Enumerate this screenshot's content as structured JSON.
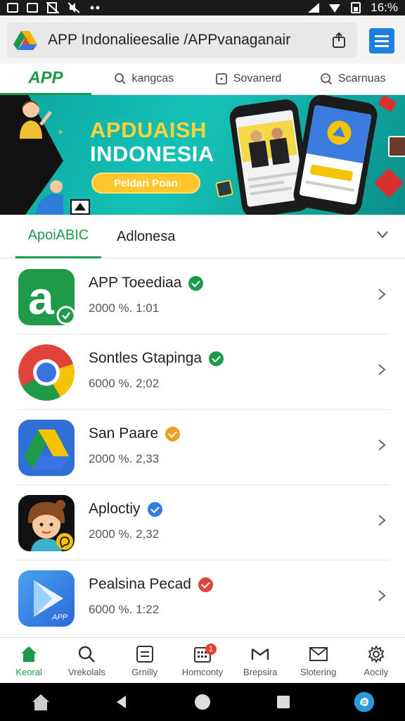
{
  "status_bar": {
    "time": "16:%",
    "left_icons": [
      "photo-icon",
      "mountain-icon",
      "no-sim-icon",
      "mute-icon",
      "dots-icon"
    ],
    "right_icons": [
      "signal-icon",
      "wifi-icon",
      "battery-icon"
    ]
  },
  "address_bar": {
    "url": "APP Indonalieesalie /APPvanaganair"
  },
  "top_tabs": {
    "logo": "APP",
    "items": [
      {
        "label": "kangcas",
        "icon": "search-icon"
      },
      {
        "label": "Sovanerd",
        "icon": "square-icon"
      },
      {
        "label": "Scarnuas",
        "icon": "smile-icon"
      }
    ]
  },
  "banner": {
    "title_line1": "APDUAISH",
    "title_line2": "INDONESIA",
    "button_label": "Peldari Poan"
  },
  "section_tabs": {
    "active": "ApoiABIC",
    "other": "Adlonesa"
  },
  "apps": [
    {
      "name": "APP Toeediaa",
      "meta": "2000 %. 1:01",
      "badge_color": "#1a9a4a"
    },
    {
      "name": "Sontles Gtapinga",
      "meta": "6000 %. 2;02",
      "badge_color": "#1a9a4a"
    },
    {
      "name": "San Paare",
      "meta": "2000 %. 2,33",
      "badge_color": "#f0a020"
    },
    {
      "name": "Aploctiy",
      "meta": "2000 %. 2,32",
      "badge_color": "#2f7ee0"
    },
    {
      "name": "Pealsina Pecad",
      "meta": "6000 %. 1:22",
      "badge_color": "#e0433a"
    }
  ],
  "bottom_nav": [
    {
      "label": "Keoral",
      "icon": "home-icon",
      "active": true
    },
    {
      "label": "Vrekolals",
      "icon": "search-icon"
    },
    {
      "label": "Grnilly",
      "icon": "list-icon"
    },
    {
      "label": "Homconty",
      "icon": "grid-icon",
      "badge": "1"
    },
    {
      "label": "Brepsira",
      "icon": "mail-icon"
    },
    {
      "label": "Slotering",
      "icon": "envelope-icon"
    },
    {
      "label": "Aocily",
      "icon": "settings-icon"
    }
  ],
  "colors": {
    "accent_green": "#1a9a4a",
    "menu_blue": "#1f7fe0",
    "banner_teal": "#15c2b6",
    "banner_yellow": "#ffd23a"
  }
}
